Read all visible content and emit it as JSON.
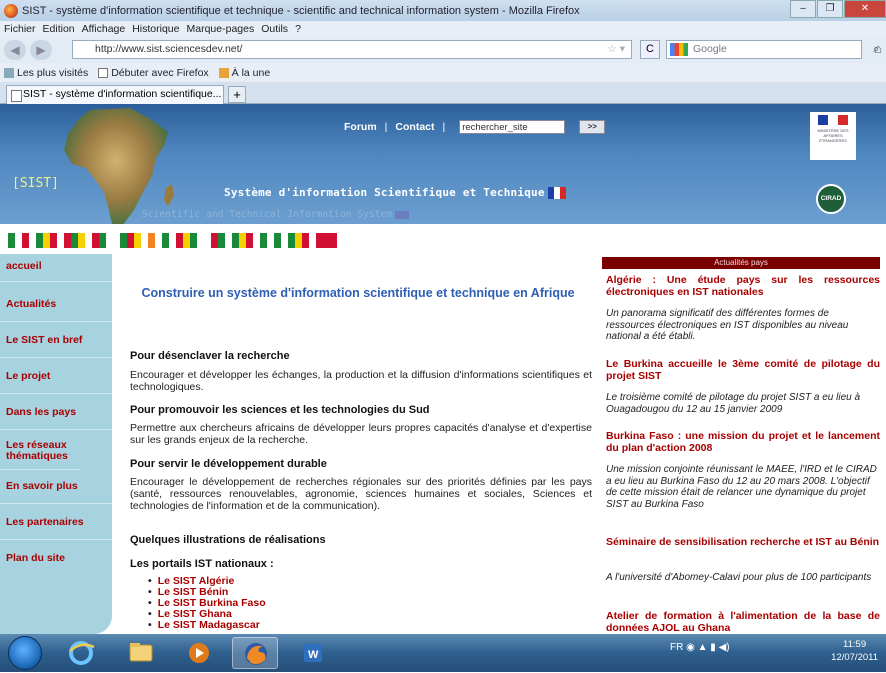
{
  "window": {
    "title": "SIST - système d'information scientifique et technique - scientific and technical information system - Mozilla Firefox",
    "controls": {
      "minimize": "–",
      "maximize": "❐",
      "close": "✕"
    }
  },
  "menu": [
    "Fichier",
    "Edition",
    "Affichage",
    "Historique",
    "Marque-pages",
    "Outils",
    "?"
  ],
  "nav": {
    "url": "http://www.sist.sciencesdev.net/",
    "search_placeholder": "Google",
    "back_icon": "arrow-left-icon",
    "forward_icon": "arrow-right-icon",
    "reload_label": "C",
    "search_button": "⌕",
    "home_button": "⌂"
  },
  "bookmarks": [
    "Les plus visités",
    "Débuter avec Firefox",
    "À la une"
  ],
  "tab": {
    "label": "SIST - système d'information scientifique...",
    "new_tab": "+"
  },
  "site": {
    "logo": "[SIST]",
    "topnav": {
      "forum": "Forum",
      "contact": "Contact",
      "separator": "|",
      "search_value": "rechercher_site",
      "search_button": ">>"
    },
    "title_fr": "Système d'information Scientifique et Technique",
    "title_en": "Scientific and Technical Information System",
    "cirad": "CIRAD",
    "marianne": "MINISTÈRE DES AFFAIRES ÉTRANGÈRES"
  },
  "flags": [
    {
      "name": "algeria",
      "colors": [
        "#1a8a3a",
        "#ffffff",
        "#d21034"
      ]
    },
    {
      "name": "benin",
      "colors": [
        "#1a8a3a",
        "#f5d100",
        "#d21034"
      ]
    },
    {
      "name": "burkina",
      "colors": [
        "#d21034",
        "#1a8a3a",
        "#f5d100"
      ]
    },
    {
      "name": "burundi",
      "colors": [
        "#d21034",
        "#1a8a3a",
        "#ffffff"
      ]
    },
    {
      "name": "cameroon",
      "colors": [
        "#1a8a3a",
        "#d21034",
        "#f5d100"
      ]
    },
    {
      "name": "ivory-coast",
      "colors": [
        "#f58220",
        "#ffffff",
        "#1a8a3a"
      ]
    },
    {
      "name": "ghana",
      "colors": [
        "#d21034",
        "#f5d100",
        "#1a8a3a"
      ]
    },
    {
      "name": "madagascar",
      "colors": [
        "#ffffff",
        "#d21034",
        "#1a8a3a"
      ]
    },
    {
      "name": "mali",
      "colors": [
        "#1a8a3a",
        "#f5d100",
        "#d21034"
      ]
    },
    {
      "name": "nigeria",
      "colors": [
        "#1a8a3a",
        "#ffffff",
        "#1a8a3a"
      ]
    },
    {
      "name": "senegal",
      "colors": [
        "#1a8a3a",
        "#f5d100",
        "#d21034"
      ]
    },
    {
      "name": "tunisia",
      "colors": [
        "#d21034",
        "#d21034",
        "#d21034"
      ]
    }
  ],
  "sidebar": [
    "accueil",
    "Actualités",
    "Le SIST en bref",
    "Le projet",
    "Dans les pays",
    "Les réseaux thématiques",
    "En savoir plus",
    "Les partenaires",
    "Plan du site"
  ],
  "main": {
    "title": "Construire un système d'information scientifique et technique en Afrique",
    "sections": [
      {
        "heading": "Pour désenclaver la recherche",
        "text": "Encourager et développer les échanges, la production et la diffusion d'informations scientifiques et technologiques."
      },
      {
        "heading": "Pour promouvoir les sciences et les technologies du Sud",
        "text": "Permettre aux chercheurs africains de développer leurs propres capacités d'analyse et d'expertise sur les grands enjeux de la recherche."
      },
      {
        "heading": "Pour servir le développement durable",
        "text": "Encourager le développement de recherches régionales sur des priorités définies par les pays (santé, ressources renouvelables, agronomie, sciences humaines et sociales, Sciences et technologies de l'information et de la communication)."
      }
    ],
    "illustrations_heading": "Quelques illustrations de réalisations",
    "portals_heading": "Les portails IST nationaux :",
    "portals": [
      "Le SIST Algérie",
      "Le SIST Bénin",
      "Le SIST Burkina Faso",
      "Le SIST Ghana",
      "Le SIST Madagascar"
    ]
  },
  "news": {
    "header": "Actualités pays",
    "items": [
      {
        "title": "Algérie : Une étude pays sur les ressources électroniques en IST nationales",
        "body": "Un panorama significatif des différentes formes de ressources électroniques en IST disponibles au niveau national a été établi."
      },
      {
        "title": "Le Burkina accueille le 3ème comité de pilotage du projet SIST",
        "body": "Le troisième comité de pilotage du projet SIST a eu lieu à Ouagadougou du 12 au 15 janvier 2009"
      },
      {
        "title": "Burkina Faso : une mission du projet et le lancement du plan d'action 2008",
        "body": "Une mission conjointe réunissant le MAEE, l'IRD et le CIRAD a eu lieu au Burkina Faso du 12 au 20 mars 2008. L'objectif de cette mission était de relancer une dynamique du projet SIST au Burkina Faso"
      },
      {
        "title": "Séminaire de sensibilisation recherche et IST au Bénin",
        "body": "A l'université d'Abomey-Calavi pour plus de 100 participants"
      },
      {
        "title": "Atelier de formation à l'alimentation de la base de données AJOL au Ghana",
        "body": ""
      }
    ]
  },
  "taskbar": {
    "clock_time": "11:59",
    "clock_date": "12/07/2011",
    "tray": "FR"
  }
}
